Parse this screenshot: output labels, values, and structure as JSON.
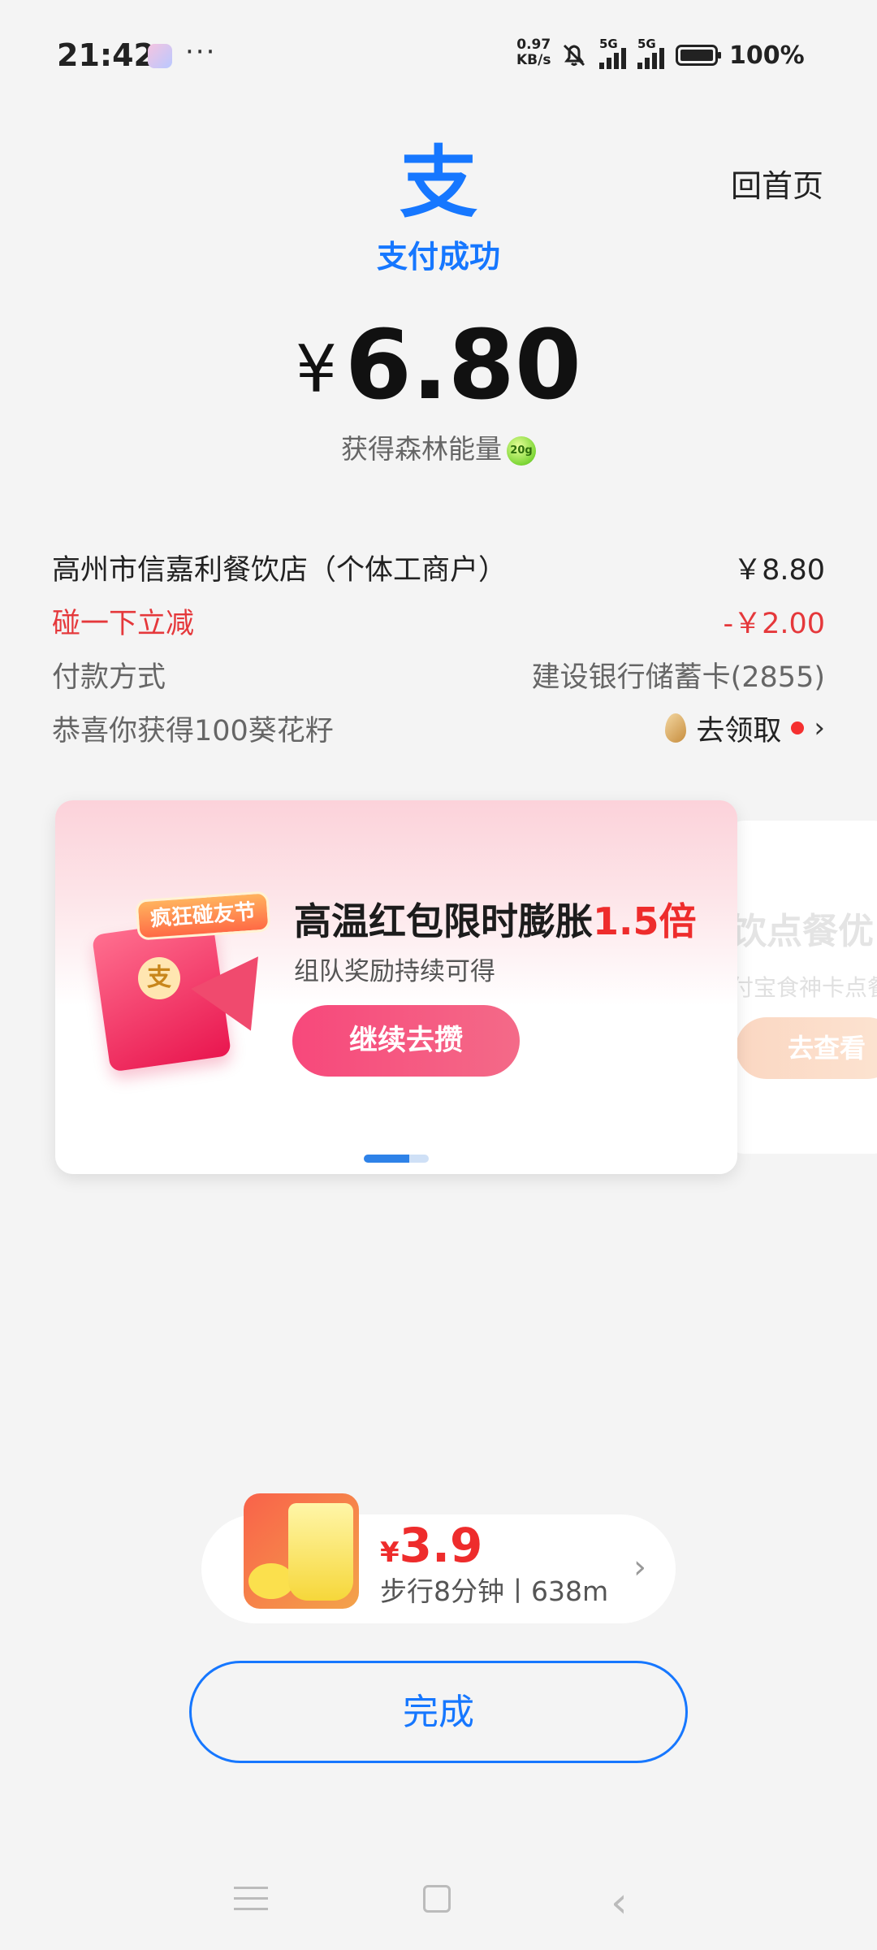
{
  "status_bar": {
    "time": "21:42",
    "more_dots": "···",
    "net_speed_value": "0.97",
    "net_speed_unit": "KB/s",
    "signal_label_1": "5G",
    "signal_label_2": "5G",
    "battery": "100%",
    "icons": [
      "app-icon",
      "mute-bell-icon",
      "signal-icon",
      "signal-icon",
      "battery-icon"
    ]
  },
  "header": {
    "logo_char": "支",
    "status": "支付成功",
    "home_link": "回首页",
    "brand_color": "#1677ff"
  },
  "payment": {
    "currency": "¥",
    "amount": "6.80",
    "energy_text": "获得森林能量",
    "energy_badge": "20g"
  },
  "details": {
    "merchant": "高州市信嘉利餐饮店（个体工商户）",
    "original_amount": "￥8.80",
    "discount_label": "碰一下立减",
    "discount_value": "-￥2.00",
    "method_label": "付款方式",
    "method_value": "建设银行储蓄卡(2855)",
    "reward_label": "恭喜你获得100葵花籽",
    "reward_action": "去领取",
    "accent_red": "#e5383b"
  },
  "banner": {
    "tag": "疯狂碰友节",
    "coin_char": "支",
    "title_main": "高温红包限时膨胀",
    "title_highlight": "1.5倍",
    "subtitle": "组队奖励持续可得",
    "button": "继续去攒"
  },
  "banner_next": {
    "title": "饮点餐优",
    "subtitle": "付宝食神卡点餐",
    "button": "去查看"
  },
  "promo": {
    "currency": "¥",
    "price": "3.9",
    "subtitle": "步行8分钟丨638m"
  },
  "done_button": "完成",
  "nav": [
    "menu-icon",
    "home-icon",
    "back-icon"
  ]
}
